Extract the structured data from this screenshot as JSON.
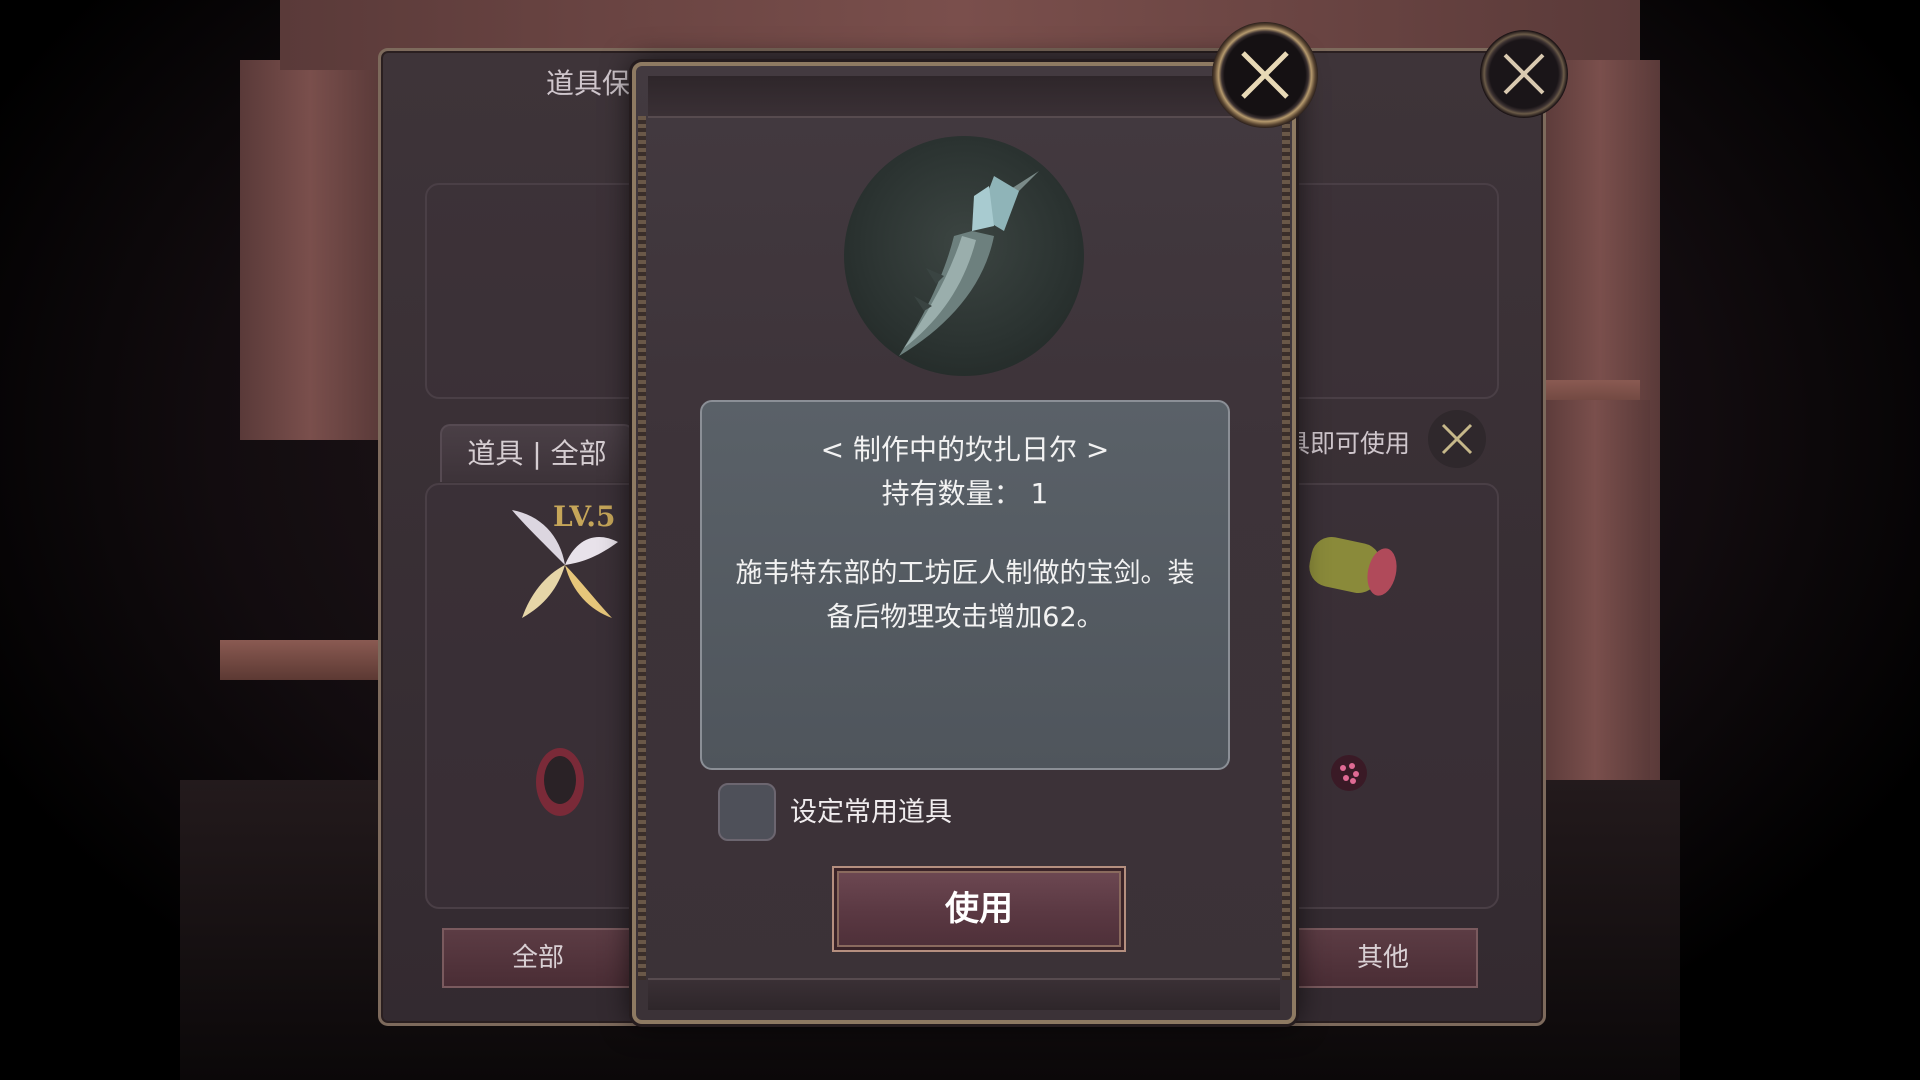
{
  "background_panel": {
    "title": "道具保管箱",
    "tab_label": "道具 | 全部",
    "level_badge": "LV.5",
    "hint_text": "点击道具即可使用",
    "bottom_tabs": {
      "all": "全部",
      "other": "其他"
    }
  },
  "dialog": {
    "item_name": "< 制作中的坎扎日尔 >",
    "item_count": "持有数量： 1",
    "item_description": "施韦特东部的工坊匠人制做的宝剑。装备后物理攻击增加62。",
    "favorite_checkbox_label": "设定常用道具",
    "use_button_label": "使用"
  },
  "colors": {
    "accent_gold": "#b69a6e",
    "use_button": "#5a3842",
    "info_box": "#545b62"
  },
  "icons": [
    "close-icon",
    "sword-icon",
    "wings-icon",
    "food-icon",
    "gem-icon",
    "pouch-icon"
  ]
}
